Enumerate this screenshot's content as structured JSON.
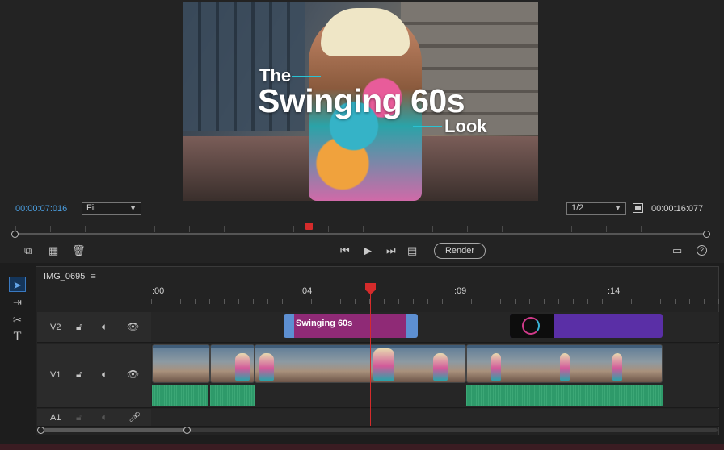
{
  "program_monitor": {
    "video_title": {
      "line1": "The",
      "line2": "Swinging 60s",
      "line3": "Look"
    },
    "current_timecode": "00:00:07:016",
    "zoom_select": "Fit",
    "resolution_select": "1/2",
    "duration_timecode": "00:00:16:077",
    "render_label": "Render"
  },
  "timeline": {
    "sequence_name": "IMG_0695",
    "menu_glyph": "≡",
    "ruler": [
      ":00",
      ":04",
      ":09",
      ":14"
    ],
    "tracks": {
      "v2": "V2",
      "v1": "V1",
      "a1": "A1"
    },
    "clips": {
      "title_clip": "Swinging 60s"
    }
  },
  "icons": {
    "selection": "selection-tool-icon",
    "track_select": "track-select-icon",
    "razor": "razor-icon",
    "type": "type-tool-icon"
  },
  "colors": {
    "accent_timecode": "#4a9ee0",
    "playhead": "#d42b2b",
    "title_clip": "#8f2a76",
    "video_clip_audio": "#2e9a6a",
    "purple_clip": "#5a2fa6"
  }
}
